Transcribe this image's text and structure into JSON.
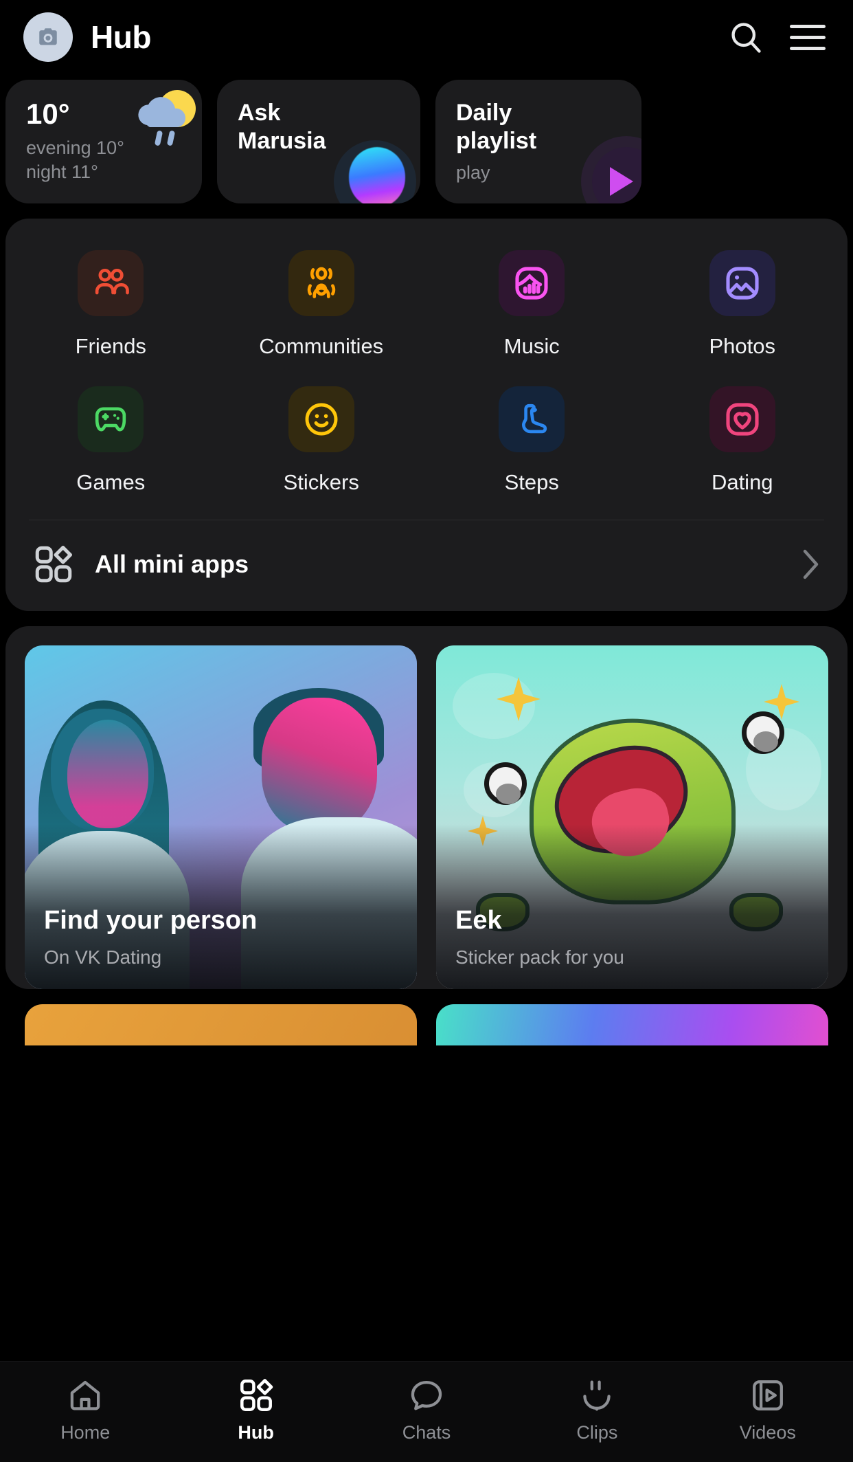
{
  "header": {
    "avatar_icon": "camera-icon",
    "title": "Hub",
    "search_icon": "search-icon",
    "menu_icon": "hamburger-menu-icon"
  },
  "widgets": [
    {
      "kind": "weather",
      "temperature": "10°",
      "evening": "evening 10°",
      "night": "night 11°",
      "icon": "sun-behind-rain-cloud-icon"
    },
    {
      "kind": "assistant",
      "title_line1": "Ask",
      "title_line2": "Marusia",
      "icon": "marusia-orb-icon"
    },
    {
      "kind": "playlist",
      "title_line1": "Daily",
      "title_line2": "playlist",
      "subtitle": "play",
      "icon": "play-icon"
    }
  ],
  "mini_apps": {
    "tiles": [
      {
        "label": "Friends",
        "icon": "friends-icon",
        "fg": "#F04E35",
        "bg": "#32201c"
      },
      {
        "label": "Communities",
        "icon": "communities-icon",
        "fg": "#FFA000",
        "bg": "#33280f"
      },
      {
        "label": "Music",
        "icon": "music-icon",
        "fg": "#F953F0",
        "bg": "#2e1630"
      },
      {
        "label": "Photos",
        "icon": "photos-icon",
        "fg": "#A38CFF",
        "bg": "#232140"
      },
      {
        "label": "Games",
        "icon": "games-icon",
        "fg": "#4CD964",
        "bg": "#1a2b1d"
      },
      {
        "label": "Stickers",
        "icon": "stickers-icon",
        "fg": "#FFC60A",
        "bg": "#332a10"
      },
      {
        "label": "Steps",
        "icon": "steps-icon",
        "fg": "#2B87F0",
        "bg": "#14243a"
      },
      {
        "label": "Dating",
        "icon": "dating-icon",
        "fg": "#F0457E",
        "bg": "#331426"
      }
    ],
    "all_apps_label": "All mini apps",
    "all_apps_icon": "mini-apps-grid-icon",
    "chevron_icon": "chevron-right-icon"
  },
  "promos": [
    {
      "title": "Find your person",
      "subtitle": "On VK Dating",
      "art": "dating-couple-photo"
    },
    {
      "title": "Eek",
      "subtitle": "Sticker pack for you",
      "art": "eek-frog-sticker"
    }
  ],
  "bottom_nav": {
    "items": [
      {
        "label": "Home",
        "icon": "home-icon",
        "active": false
      },
      {
        "label": "Hub",
        "icon": "hub-icon",
        "active": true
      },
      {
        "label": "Chats",
        "icon": "chats-icon",
        "active": false
      },
      {
        "label": "Clips",
        "icon": "clips-icon",
        "active": false
      },
      {
        "label": "Videos",
        "icon": "videos-icon",
        "active": false
      }
    ]
  },
  "colors": {
    "background": "#000000",
    "card": "#1c1c1e",
    "text_primary": "#ffffff",
    "text_secondary": "#8e9095"
  }
}
